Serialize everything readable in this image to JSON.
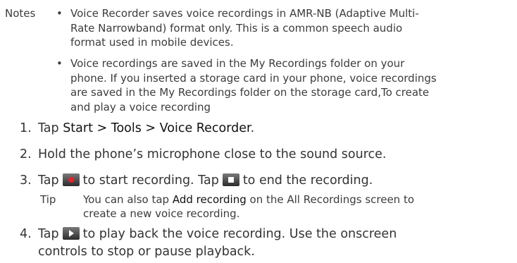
{
  "notes": {
    "label": "Notes",
    "bullets": [
      {
        "lines": [
          "Voice Recorder saves voice recordings in AMR-NB (Adaptive Multi-",
          "Rate Narrowband) format only. This is a common speech audio",
          "format used in mobile devices."
        ]
      },
      {
        "lines": [
          "Voice recordings are saved in the My Recordings folder on your",
          "phone. If you inserted a storage card in your phone, voice recordings",
          "are saved in the My Recordings folder on the storage card,To create",
          "and play a voice recording"
        ]
      }
    ]
  },
  "steps": {
    "s1": {
      "num": "1.",
      "pre": "Tap ",
      "bold": "Start > Tools > Voice Recorder",
      "post": "."
    },
    "s2": {
      "num": "2.",
      "text": "Hold the phone’s microphone close to the sound source."
    },
    "s3": {
      "num": "3.",
      "pre": "Tap",
      "mid": "to start recording. Tap",
      "post": "to end the recording."
    },
    "s4": {
      "num": "4.",
      "pre": "Tap",
      "post": "to play back the voice recording. Use the onscreen",
      "line2": "controls to stop or pause playback."
    }
  },
  "tip": {
    "label": "Tip",
    "pre": "You can also tap ",
    "bold": "Add recording",
    "post": " on the All Recordings screen to",
    "line2": "create a new voice recording."
  },
  "icons": [
    "record-icon",
    "stop-icon",
    "play-icon"
  ],
  "colors": {
    "record": "#e8212b",
    "icon_bg": "#3c3c3c",
    "text": "#3c3c3c"
  }
}
